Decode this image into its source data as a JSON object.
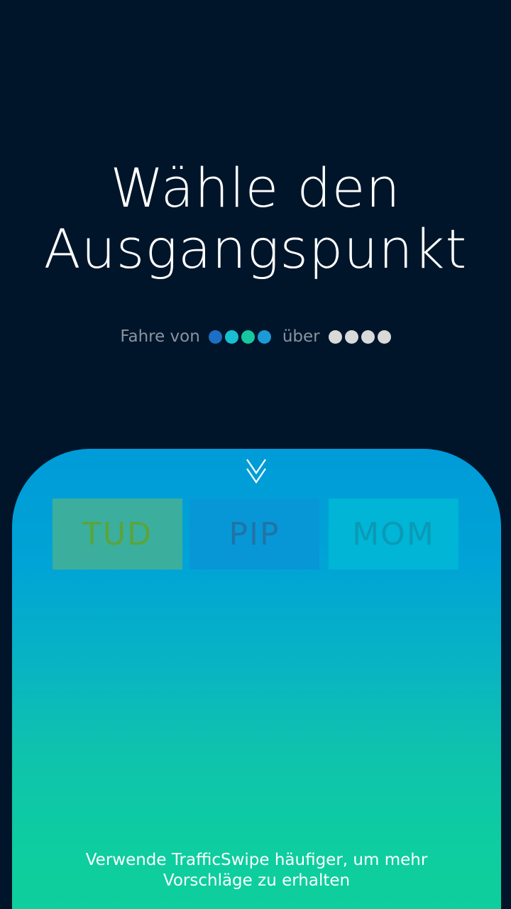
{
  "header": {
    "title_line1": "Wähle den",
    "title_line2": "Ausgangspunkt"
  },
  "route": {
    "from_label": "Fahre von",
    "via_label": "über",
    "from_dots": [
      "#1c6fc4",
      "#18bfd1",
      "#16c8a0",
      "#1b9ad6"
    ],
    "via_dots": [
      "#d9d9d9",
      "#d9d9d9",
      "#d9d9d9",
      "#d9d9d9"
    ]
  },
  "sheet": {
    "handle_icon": "double-chevron-down-icon",
    "options": [
      {
        "label": "TUD"
      },
      {
        "label": "PIP"
      },
      {
        "label": "MOM"
      }
    ],
    "hint_line1": "Verwende TrafficSwipe häufiger, um mehr",
    "hint_line2": "Vorschläge zu erhalten"
  }
}
